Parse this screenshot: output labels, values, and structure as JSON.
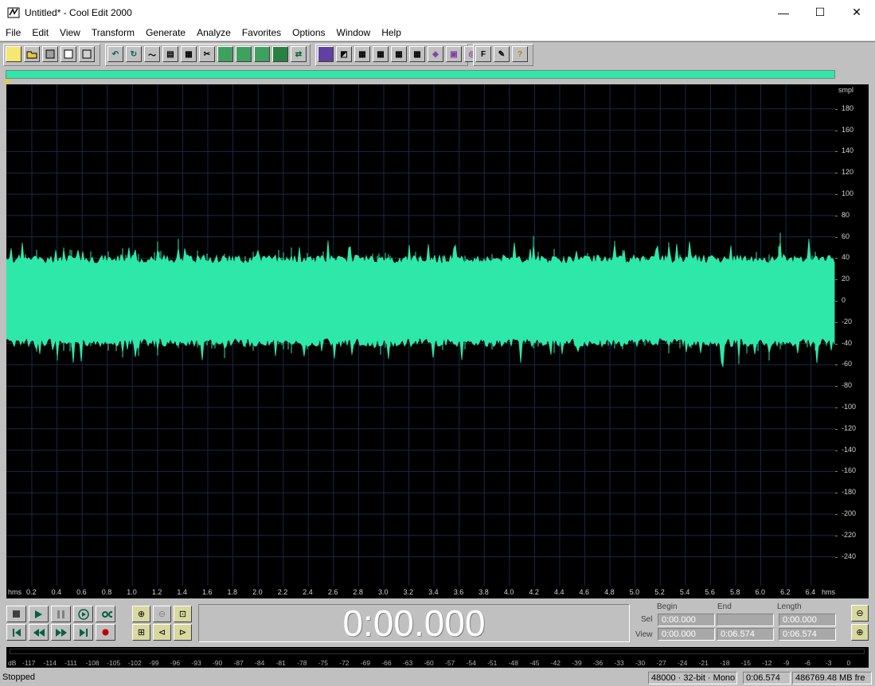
{
  "window": {
    "title": "Untitled* - Cool Edit 2000",
    "minimize": "—",
    "maximize": "☐",
    "close": "✕"
  },
  "menu": [
    "File",
    "Edit",
    "View",
    "Transform",
    "Generate",
    "Analyze",
    "Favorites",
    "Options",
    "Window",
    "Help"
  ],
  "toolbar": {
    "help_label": "?",
    "favorites_label": "F"
  },
  "waveform": {
    "color": "#2de8a8",
    "y_unit": "smpl",
    "y_ticks": [
      "180",
      "160",
      "140",
      "120",
      "100",
      "80",
      "60",
      "40",
      "20",
      "0",
      "-20",
      "-40",
      "-60",
      "-80",
      "-100",
      "-120",
      "-140",
      "-160",
      "-180",
      "-200",
      "-220",
      "-240"
    ],
    "x_unit_start": "hms",
    "x_unit_end": "hms",
    "x_ticks": [
      "0.2",
      "0.4",
      "0.6",
      "0.8",
      "1.0",
      "1.2",
      "1.4",
      "1.6",
      "1.8",
      "2.0",
      "2.2",
      "2.4",
      "2.6",
      "2.8",
      "3.0",
      "3.2",
      "3.4",
      "3.6",
      "3.8",
      "4.0",
      "4.2",
      "4.4",
      "4.6",
      "4.8",
      "5.0",
      "5.2",
      "5.4",
      "5.6",
      "5.8",
      "6.0",
      "6.2",
      "6.4"
    ]
  },
  "time_display": "0:00.000",
  "selection": {
    "begin_label": "Begin",
    "end_label": "End",
    "length_label": "Length",
    "sel_label": "Sel",
    "view_label": "View",
    "sel_begin": "0:00.000",
    "sel_end": "",
    "sel_length": "0:00.000",
    "view_begin": "0:00.000",
    "view_end": "0:06.574",
    "view_length": "0:06.574"
  },
  "meter": {
    "unit": "dB",
    "ticks": [
      "-117",
      "-114",
      "-111",
      "-108",
      "-105",
      "-102",
      "-99",
      "-96",
      "-93",
      "-90",
      "-87",
      "-84",
      "-81",
      "-78",
      "-75",
      "-72",
      "-69",
      "-66",
      "-63",
      "-60",
      "-57",
      "-54",
      "-51",
      "-48",
      "-45",
      "-42",
      "-39",
      "-36",
      "-33",
      "-30",
      "-27",
      "-24",
      "-21",
      "-18",
      "-15",
      "-12",
      "-9",
      "-6",
      "-3",
      "0"
    ]
  },
  "status": {
    "state": "Stopped",
    "format": "48000 · 32-bit · Mono",
    "duration": "0:06.574",
    "free_space": "486769.48 MB fre"
  }
}
